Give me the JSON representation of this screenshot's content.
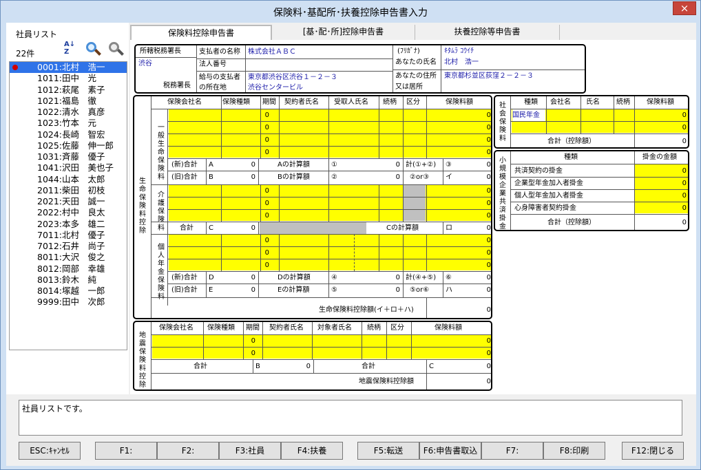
{
  "window": {
    "title": "保険料･基配所･扶養控除申告書入力",
    "close_glyph": "×"
  },
  "employees": {
    "title": "社員リスト",
    "count": "22件",
    "sort_glyph": "A↓\nZ",
    "items": [
      "0001:北村　浩一",
      "1011:田中　光",
      "1012:萩尾　素子",
      "1021:福島　徹",
      "1022:清水　真彦",
      "1023:竹本　元",
      "1024:長崎　智宏",
      "1025:佐藤　伸一郎",
      "1031:斉藤　優子",
      "1041:沢田　美也子",
      "1044:山本　太郎",
      "2011:柴田　初枝",
      "2021:天田　誠一",
      "2022:村中　良太",
      "2023:本多　雄二",
      "7011:北村　優子",
      "7012:石井　尚子",
      "8011:大沢　俊之",
      "8012:岡部　幸雄",
      "8013:鈴木　純",
      "8014:塚越　一郎",
      "9999:田中　次郎"
    ]
  },
  "tabs": [
    "保険料控除申告書",
    "[基･配･所]控除申告書",
    "扶養控除等申告書"
  ],
  "header": {
    "office_label": "所轄税務署長",
    "office_name": "渋谷",
    "office_suffix": "税務署長",
    "payer_name_label": "支払者の名称",
    "payer_name": "株式会社ＡＢＣ",
    "corp_no_label": "法人番号",
    "payer_addr_label1": "給与の支払者",
    "payer_addr_label2": "の所在地",
    "payer_addr1": "東京都渋谷区渋谷１－２－３",
    "payer_addr2": "渋谷センタービル",
    "kana_label": "(ﾌﾘｶﾞﾅ)",
    "kana": "ｷﾀﾑﾗ ｺｳｲﾁ",
    "your_name_label": "あなたの氏名",
    "your_name": "北村　浩一",
    "your_addr_label1": "あなたの住所",
    "your_addr_label2": "又は居所",
    "your_addr": "東京都杉並区荻窪２－２－３"
  },
  "life": {
    "side": "生命保険料控除",
    "cols": [
      "保険会社名",
      "保険種類",
      "期間",
      "契約者氏名",
      "受取人氏名",
      "続柄",
      "区分",
      "保険料額"
    ],
    "general_label": "一般生命保険料",
    "care_label": "介護保険料",
    "pension_label": "個人年金保険料",
    "zero": "0",
    "new_total": "(新)合計",
    "old_total": "(旧)合計",
    "total": "合計",
    "A": "A",
    "B": "B",
    "C": "C",
    "D": "D",
    "E": "E",
    "a_calc": "Aの計算額",
    "b_calc": "Bの計算額",
    "c_calc": "Cの計算額",
    "d_calc": "Dの計算額",
    "e_calc": "Eの計算額",
    "c1": "①",
    "c2": "②",
    "c3": "③",
    "c4": "④",
    "c5": "⑤",
    "c6": "⑥",
    "sum12": "計(①+②)",
    "or23": "②or③",
    "sum45": "計(④+⑤)",
    "or56": "⑤or⑥",
    "i": "イ",
    "ro": "ロ",
    "ha": "ハ",
    "deduction": "生命保険料控除額(イ＋ロ＋ハ)"
  },
  "quake": {
    "side": "地震保険料控除",
    "cols": [
      "保険会社名",
      "保険種類",
      "期間",
      "契約者氏名",
      "対象者氏名",
      "続柄",
      "区分",
      "保険料額"
    ],
    "zero": "0",
    "total": "合計",
    "B": "B",
    "C": "C",
    "deduction": "地震保険料控除額"
  },
  "social": {
    "side": "社会保険料",
    "cols": [
      "種類",
      "会社名",
      "氏名",
      "続柄",
      "保険料額"
    ],
    "row1_type": "国民年金",
    "zero": "0",
    "total": "合計（控除額）"
  },
  "small": {
    "side": "小規模企業共済掛金",
    "cols": [
      "種類",
      "掛金の金額"
    ],
    "rows": [
      "共済契約の掛金",
      "企業型年金加入者掛金",
      "個人型年金加入者掛金",
      "心身障害者契約掛金"
    ],
    "zero": "0",
    "total": "合計（控除額）"
  },
  "status": {
    "message": "社員リストです。"
  },
  "fkeys": [
    "ESC:ｷｬﾝｾﾙ",
    "F1:",
    "F2:",
    "F3:社員",
    "F4:扶養",
    "F5:転送",
    "F6:申告書取込",
    "F7:",
    "F8:印刷",
    "F12:閉じる"
  ],
  "colors": {
    "accent": "#2f73e8",
    "highlight": "#ffff00",
    "titlebar": "#cfe0f3",
    "close": "#c7453a"
  }
}
